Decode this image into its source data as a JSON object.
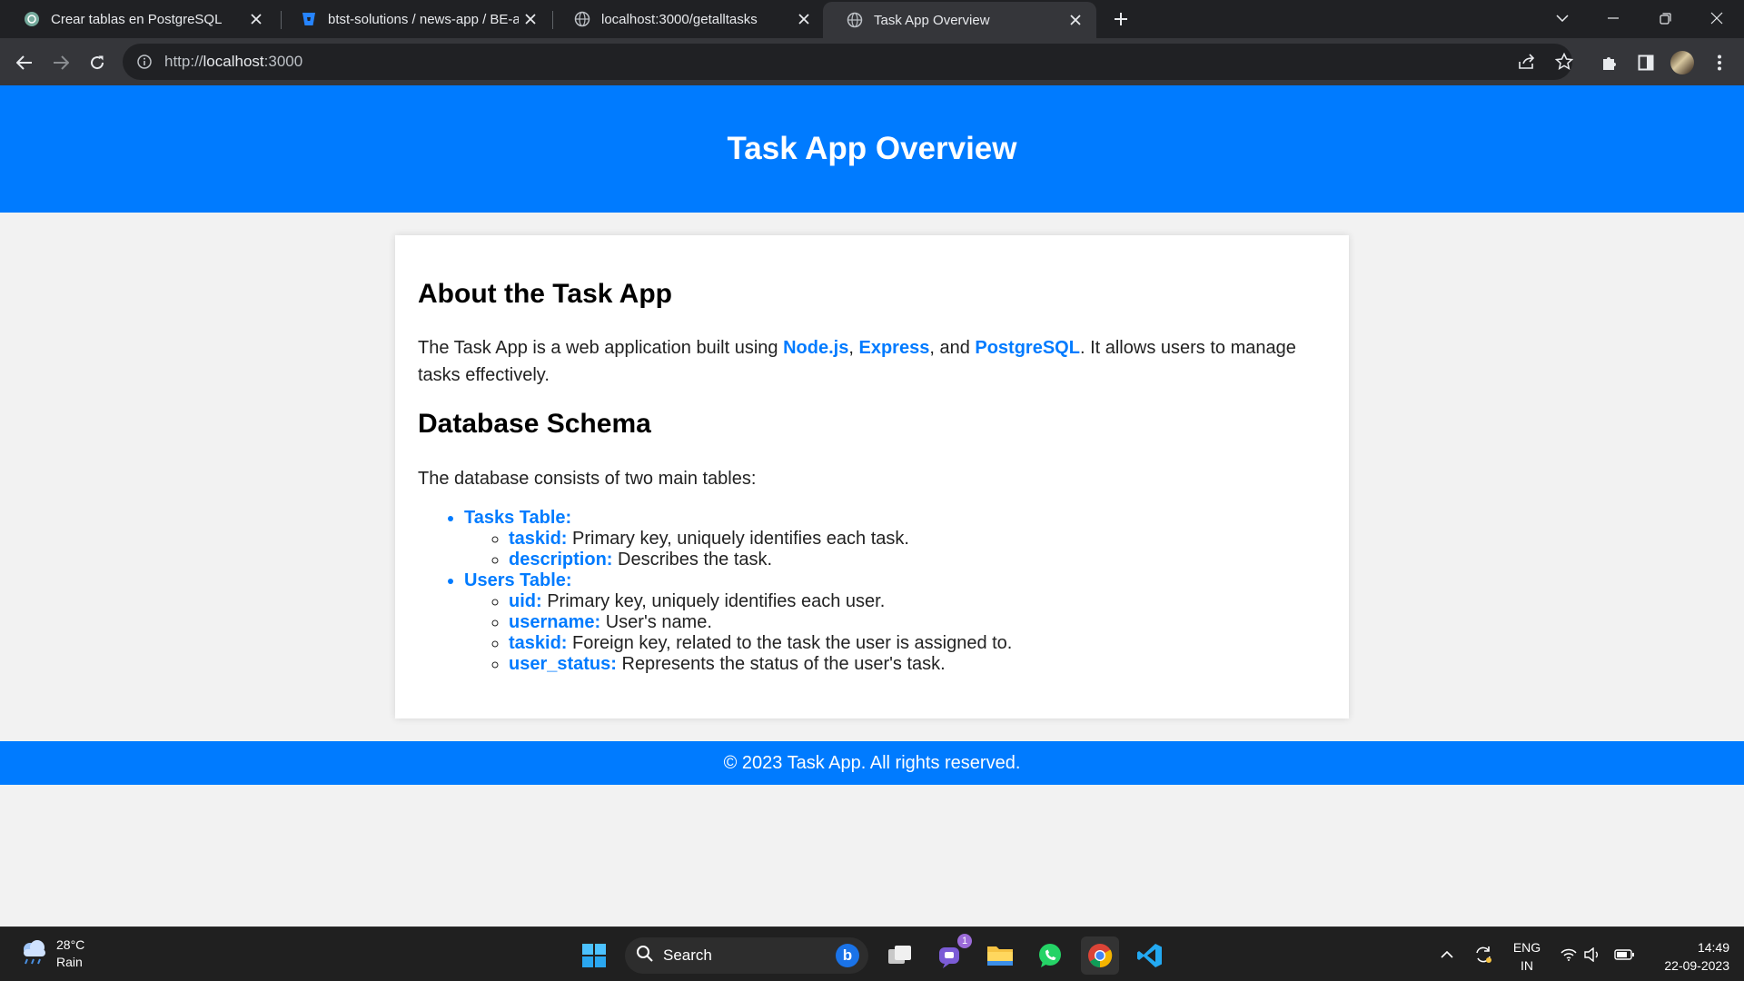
{
  "browser": {
    "tabs": [
      {
        "title": "Crear tablas en PostgreSQL",
        "icon": "chatgpt-icon"
      },
      {
        "title": "btst-solutions / news-app / BE-as",
        "icon": "bitbucket-icon"
      },
      {
        "title": "localhost:3000/getalltasks",
        "icon": "globe-icon"
      },
      {
        "title": "Task App Overview",
        "icon": "globe-icon",
        "active": true
      }
    ],
    "url_scheme": "http://",
    "url_host": "localhost",
    "url_port": ":3000"
  },
  "page": {
    "header_title": "Task App Overview",
    "about": {
      "heading": "About the Task App",
      "text_1": "The Task App is a web application built using ",
      "link_node": "Node.js",
      "sep_1": ", ",
      "link_express": "Express",
      "sep_2": ", and ",
      "link_postgres": "PostgreSQL",
      "text_2": ". It allows users to manage tasks effectively."
    },
    "schema": {
      "heading": "Database Schema",
      "intro": "The database consists of two main tables:",
      "tables": [
        {
          "name": "Tasks Table:",
          "fields": [
            {
              "key": "taskid:",
              "desc": " Primary key, uniquely identifies each task."
            },
            {
              "key": "description:",
              "desc": " Describes the task."
            }
          ]
        },
        {
          "name": "Users Table:",
          "fields": [
            {
              "key": "uid:",
              "desc": " Primary key, uniquely identifies each user."
            },
            {
              "key": "username:",
              "desc": " User's name."
            },
            {
              "key": "taskid:",
              "desc": " Foreign key, related to the task the user is assigned to."
            },
            {
              "key": "user_status:",
              "desc": " Represents the status of the user's task."
            }
          ]
        }
      ]
    },
    "footer": "© 2023 Task App. All rights reserved."
  },
  "taskbar": {
    "weather_temp": "28°C",
    "weather_desc": "Rain",
    "search_label": "Search",
    "teams_badge": "1",
    "lang_line1": "ENG",
    "lang_line2": "IN",
    "time": "14:49",
    "date": "22-09-2023"
  },
  "colors": {
    "accent": "#007bff",
    "chrome_dark": "#202124",
    "chrome_toolbar": "#35363a"
  }
}
